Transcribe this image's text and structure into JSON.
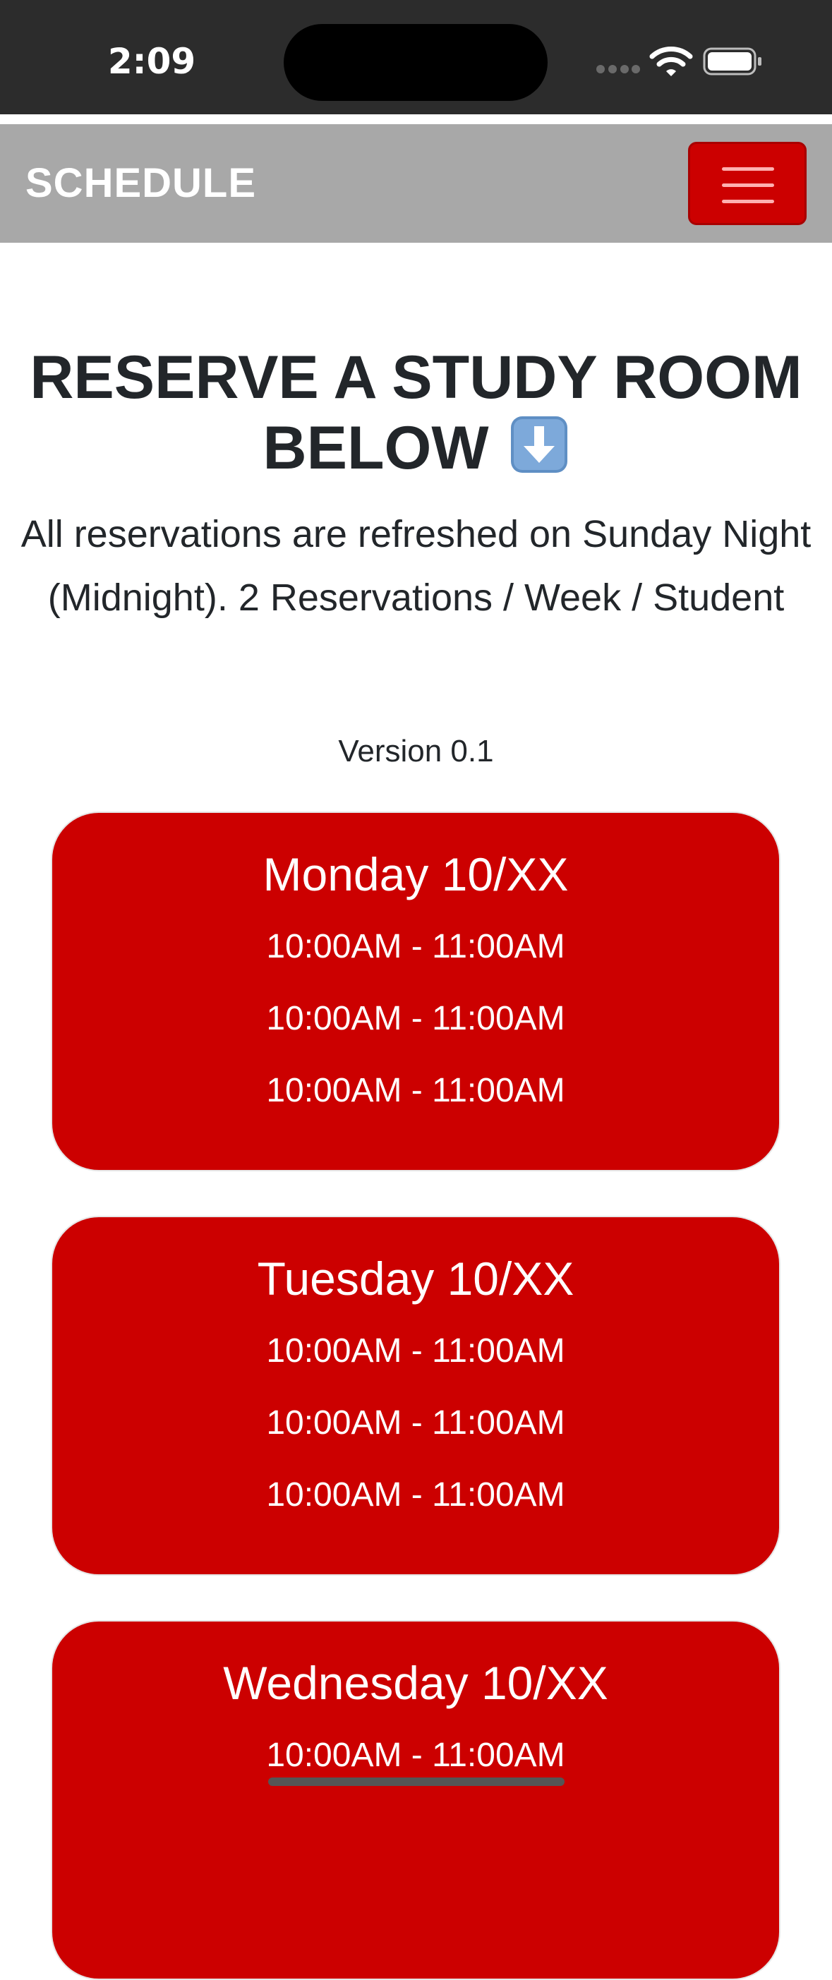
{
  "status_bar": {
    "time": "2:09",
    "icons": [
      "signal-dots-icon",
      "wifi-icon",
      "battery-icon"
    ]
  },
  "navbar": {
    "brand": "SCHEDULE",
    "menu_icon": "hamburger-menu-icon",
    "accent_color": "#cc0000",
    "background_color": "#a8a8a8"
  },
  "main": {
    "heading_line1": "RESERVE A STUDY ROOM",
    "heading_line2": "BELOW",
    "heading_icon": "down-arrow-emoji-icon",
    "subtitle": "All reservations are refreshed on Sunday Night (Midnight). 2 Reservations / Week / Student",
    "version": "Version 0.1"
  },
  "days": [
    {
      "title": "Monday 10/XX",
      "slots": [
        "10:00AM - 11:00AM",
        "10:00AM - 11:00AM",
        "10:00AM - 11:00AM"
      ]
    },
    {
      "title": "Tuesday 10/XX",
      "slots": [
        "10:00AM - 11:00AM",
        "10:00AM - 11:00AM",
        "10:00AM - 11:00AM"
      ]
    },
    {
      "title": "Wednesday 10/XX",
      "slots": [
        "10:00AM - 11:00AM"
      ]
    }
  ],
  "colors": {
    "card_background": "#cc0000",
    "heading_text": "#22262a",
    "status_bar": "#2c2c2c"
  }
}
